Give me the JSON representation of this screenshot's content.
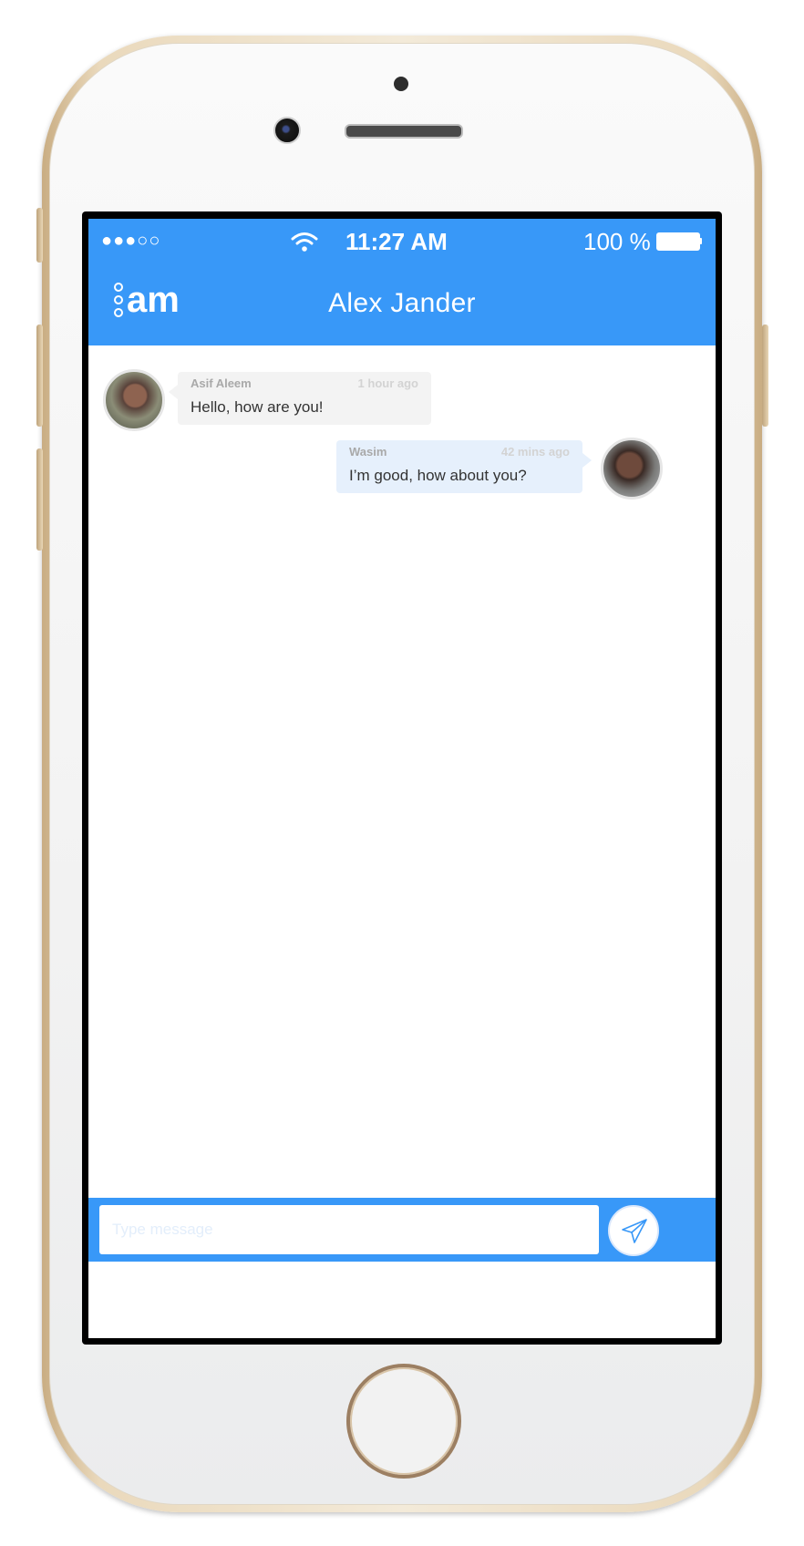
{
  "status_bar": {
    "signal": "●●●○○",
    "time": "11:27 AM",
    "battery": "100 %"
  },
  "header": {
    "logo_text": "am",
    "title": "Alex Jander"
  },
  "messages": [
    {
      "sender": "Asif Aleem",
      "time": "1 hour ago",
      "text": "Hello, how are you!",
      "side": "left"
    },
    {
      "sender": "Wasim",
      "time": "42 mins ago",
      "text": "I’m good, how about you?",
      "side": "right"
    }
  ],
  "composer": {
    "placeholder": "Type message",
    "send_icon": "paper-plane-icon"
  },
  "colors": {
    "accent": "#3898f8",
    "bubble_incoming": "#f3f3f3",
    "bubble_outgoing": "#e6f0fc"
  }
}
